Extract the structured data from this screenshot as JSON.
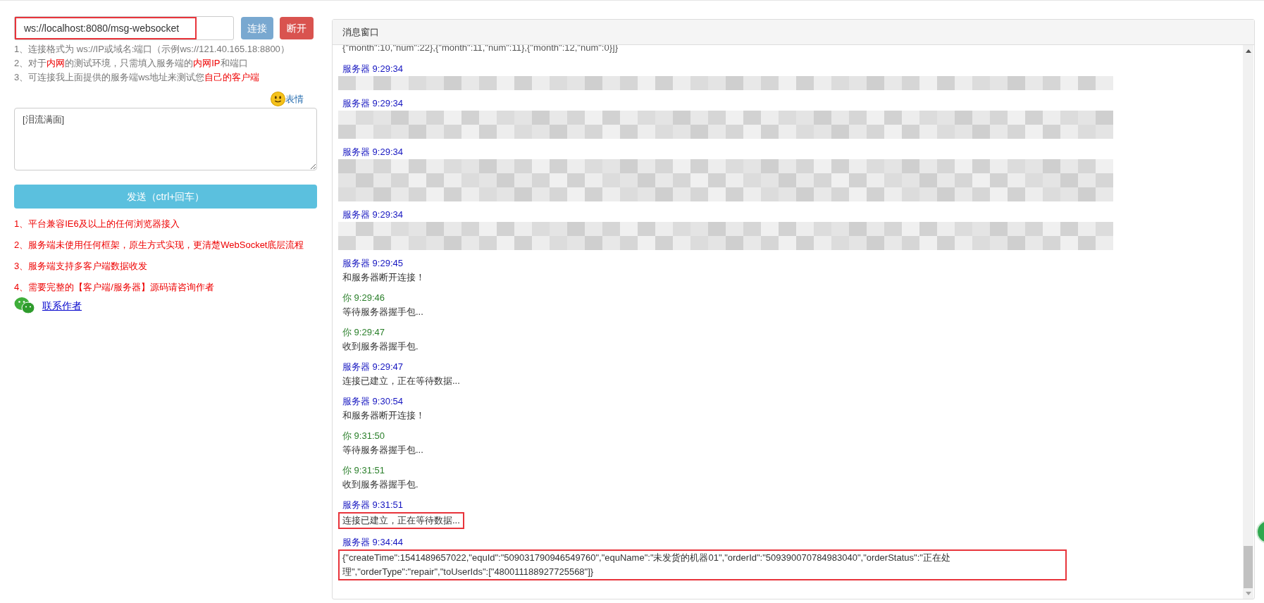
{
  "connection": {
    "url": {
      "value": "ws://localhost:8080/msg-websocket",
      "highlighted": true
    },
    "buttons": [
      {
        "kind": "connect",
        "label": "连接",
        "disabled": true
      },
      {
        "kind": "disconnect",
        "label": "断开",
        "disabled": false
      }
    ]
  },
  "hints": [
    [
      {
        "text": "1、连接格式为 ws://IP或域名:端口（示例ws://121.40.165.18:8800）",
        "highlight": false
      }
    ],
    [
      {
        "text": "2、对于",
        "highlight": false
      },
      {
        "text": "内网",
        "highlight": true
      },
      {
        "text": "的测试环境，只需填入服务端的",
        "highlight": false
      },
      {
        "text": "内网IP",
        "highlight": true
      },
      {
        "text": "和端口",
        "highlight": false
      }
    ],
    [
      {
        "text": "3、可连接我上面提供的服务端ws地址来测试您",
        "highlight": false
      },
      {
        "text": "自己的客户端",
        "highlight": true
      }
    ]
  ],
  "emoji_button": {
    "label": "表情"
  },
  "message_input": {
    "value": "[泪流满面]"
  },
  "send_button": {
    "label": "发送（ctrl+回车）"
  },
  "notes": [
    "1、平台兼容IE6及以上的任何浏览器接入",
    "2、服务端未使用任何框架，原生方式实现，更清楚WebSocket底层流程",
    "3、服务端支持多客户端数据收发",
    "4、需要完整的【客户端/服务器】源码请咨询作者"
  ],
  "contact_link": {
    "label": "联系作者"
  },
  "message_window": {
    "title": "消息窗口",
    "messages": [
      {
        "kind": "continuation",
        "text": "{\"month\":10,\"num\":22},{\"month\":11,\"num\":11},{\"month\":12,\"num\":0}]}"
      },
      {
        "kind": "blurred1",
        "header": "服务器 9:29:34"
      },
      {
        "kind": "blurred2",
        "header": "服务器 9:29:34"
      },
      {
        "kind": "blurred3",
        "header": "服务器 9:29:34"
      },
      {
        "kind": "blurred2",
        "header": "服务器 9:29:34"
      },
      {
        "kind": "server",
        "header": "服务器 9:29:45",
        "text": "和服务器断开连接！",
        "highlighted": false
      },
      {
        "kind": "client",
        "header": "你 9:29:46",
        "text": "等待服务器握手包...",
        "highlighted": false
      },
      {
        "kind": "client",
        "header": "你 9:29:47",
        "text": "收到服务器握手包.",
        "highlighted": false
      },
      {
        "kind": "server",
        "header": "服务器 9:29:47",
        "text": "连接已建立，正在等待数据...",
        "highlighted": false
      },
      {
        "kind": "server",
        "header": "服务器 9:30:54",
        "text": "和服务器断开连接！",
        "highlighted": false
      },
      {
        "kind": "client",
        "header": "你 9:31:50",
        "text": "等待服务器握手包...",
        "highlighted": false
      },
      {
        "kind": "client",
        "header": "你 9:31:51",
        "text": "收到服务器握手包.",
        "highlighted": false
      },
      {
        "kind": "server",
        "header": "服务器 9:31:51",
        "text": "连接已建立，正在等待数据...",
        "highlighted": true
      },
      {
        "kind": "server",
        "header": "服务器 9:34:44",
        "text": "{\"createTime\":1541489657022,\"equId\":\"509031790946549760\",\"equName\":\"未发货的机器01\",\"orderId\":\"509390070784983040\",\"orderStatus\":\"正在处理\",\"orderType\":\"repair\",\"toUserIds\":[\"480011188927725568\"]}",
        "highlighted": true
      }
    ]
  }
}
